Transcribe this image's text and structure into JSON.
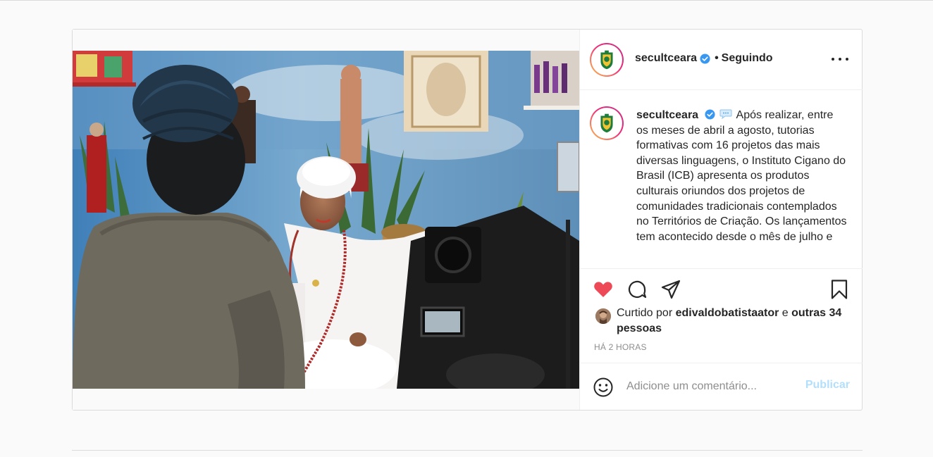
{
  "post": {
    "username": "secultceara",
    "separator": "•",
    "follow_label": "Seguindo",
    "caption": "Após realizar, entre os meses de abril a agosto, tutorias formativas com 16 projetos das mais diversas linguagens, o Instituto Cigano do Brasil (ICB) apresenta os produtos culturais oriundos dos projetos de comunidades tradicionais contemplados no Territórios de Criação. Os lançamentos tem acontecido desde o mês de julho e",
    "liked_prefix": "Curtido por",
    "liked_user": "edivaldobatistaator",
    "liked_and": "e",
    "liked_others": "outras 34 pessoas",
    "timestamp": "HÁ 2 HORAS",
    "comment_placeholder": "Adicione um comentário...",
    "publish_label": "Publicar"
  },
  "icons": {
    "like": "heart-filled-icon",
    "comment": "comment-bubble-icon",
    "share": "paper-plane-icon",
    "save": "bookmark-icon",
    "emoji": "smiley-icon",
    "more": "more-options-icon",
    "verified": "verified-badge-icon"
  },
  "colors": {
    "like": "#ed4956",
    "verified": "#3897f0",
    "link_disabled": "#b2dffc",
    "muted": "#8e8e8e"
  }
}
